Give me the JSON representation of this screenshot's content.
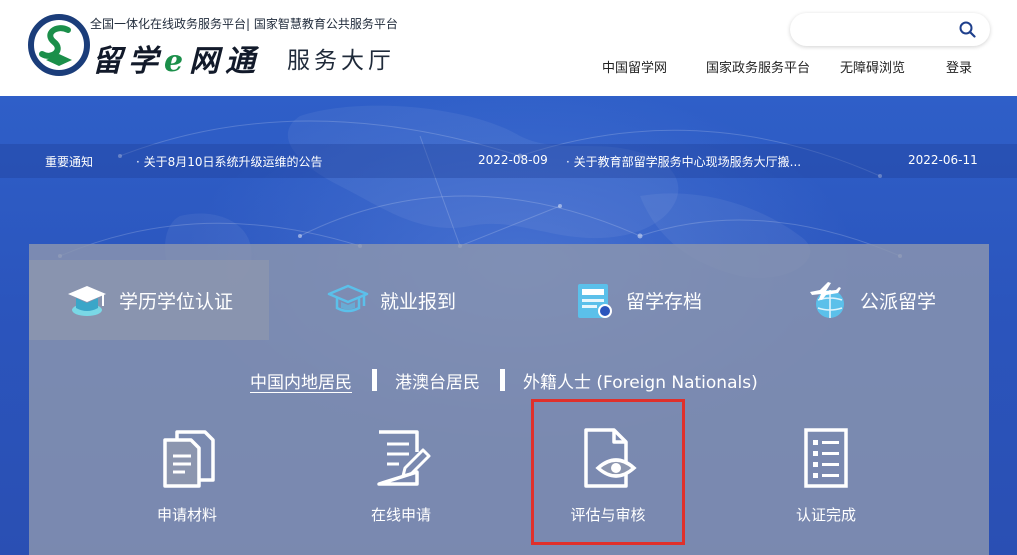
{
  "header": {
    "top_line": "全国一体化在线政务服务平台| 国家智慧教育公共服务平台",
    "logo_name_1": "留学",
    "logo_name_e": "e",
    "logo_name_2": "网通",
    "logo_sub": "服务大厅",
    "search": {
      "placeholder": "",
      "icon": "search-icon"
    },
    "nav": [
      "中国留学网",
      "国家政务服务平台",
      "无障碍浏览",
      "登录"
    ]
  },
  "notice": {
    "label": "重要通知",
    "items": [
      {
        "title": "· 关于8月10日系统升级运维的公告",
        "date": "2022-08-09"
      },
      {
        "title": "· 关于教育部留学服务中心现场服务大厅搬...",
        "date": "2022-06-11"
      }
    ]
  },
  "tabs": [
    {
      "label": "学历学位认证",
      "icon": "graduation-cap-icon",
      "active": true
    },
    {
      "label": "就业报到",
      "icon": "graduation-cap-outline-icon",
      "active": false
    },
    {
      "label": "留学存档",
      "icon": "document-card-icon",
      "active": false
    },
    {
      "label": "公派留学",
      "icon": "airplane-globe-icon",
      "active": false
    }
  ],
  "categories": [
    {
      "label": "中国内地居民",
      "active": true
    },
    {
      "label": "港澳台居民",
      "active": false
    },
    {
      "label": "外籍人士 (Foreign Nationals)",
      "active": false
    }
  ],
  "steps": [
    {
      "label": "申请材料",
      "icon": "documents-icon"
    },
    {
      "label": "在线申请",
      "icon": "edit-form-icon"
    },
    {
      "label": "评估与审核",
      "icon": "document-eye-icon"
    },
    {
      "label": "认证完成",
      "icon": "checklist-icon"
    }
  ],
  "colors": {
    "banner_blue": "#2b55bd",
    "panel_gray": "#8c96af",
    "highlight_red": "#e0302b",
    "logo_green": "#1b8f4a"
  }
}
